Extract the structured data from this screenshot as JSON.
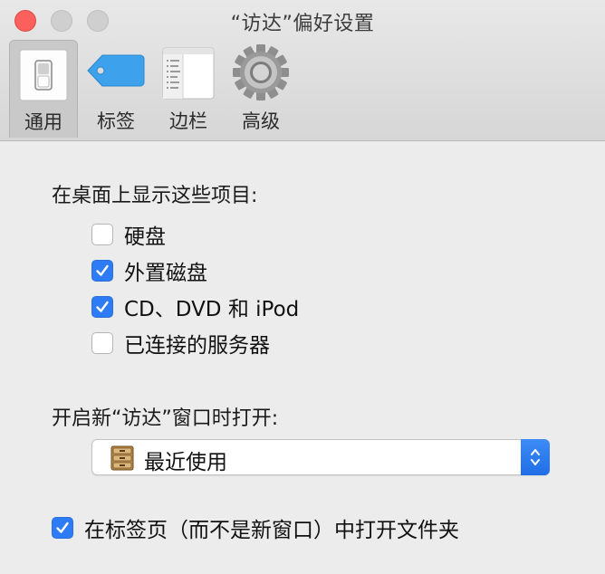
{
  "window": {
    "title": "“访达”偏好设置"
  },
  "toolbar": {
    "tabs": [
      {
        "label": "通用",
        "icon": "general-switch-icon",
        "selected": true
      },
      {
        "label": "标签",
        "icon": "tag-icon",
        "selected": false
      },
      {
        "label": "边栏",
        "icon": "sidebar-icon",
        "selected": false
      },
      {
        "label": "高级",
        "icon": "gear-icon",
        "selected": false
      }
    ]
  },
  "desktop_section": {
    "heading": "在桌面上显示这些项目:",
    "items": [
      {
        "label": "硬盘",
        "checked": false
      },
      {
        "label": "外置磁盘",
        "checked": true
      },
      {
        "label": "CD、DVD 和 iPod",
        "checked": true
      },
      {
        "label": "已连接的服务器",
        "checked": false
      }
    ]
  },
  "new_window_section": {
    "heading": "开启新“访达”窗口时打开:",
    "popup_value": "最近使用",
    "popup_icon": "recents-cabinet-icon"
  },
  "tabs_option": {
    "label": "在标签页（而不是新窗口）中打开文件夹",
    "checked": true
  },
  "colors": {
    "accent": "#2e7bf6",
    "close": "#fc605c"
  }
}
